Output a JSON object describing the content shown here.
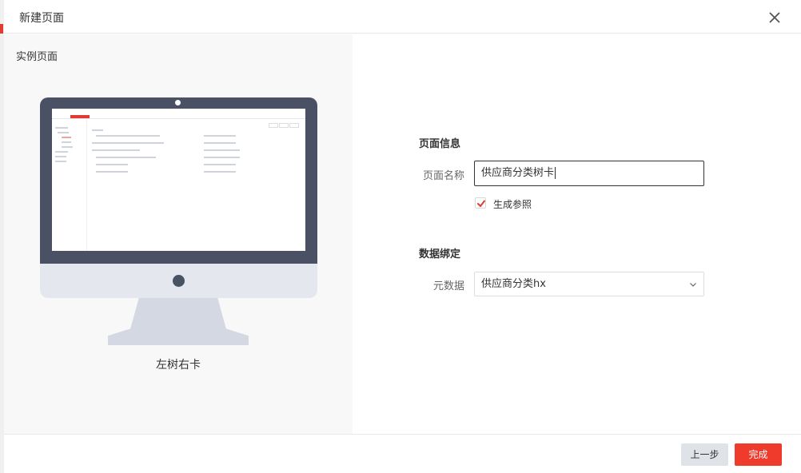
{
  "modal": {
    "title": "新建页面",
    "close_icon": "close-icon"
  },
  "preview": {
    "title": "实例页面",
    "template_name": "左树右卡"
  },
  "page_info": {
    "section_title": "页面信息",
    "name_label": "页面名称",
    "name_value": "供应商分类树卡",
    "generate_ref_label": "生成参照",
    "generate_ref_checked": true
  },
  "data_binding": {
    "section_title": "数据绑定",
    "metadata_label": "元数据",
    "metadata_value": "供应商分类hx"
  },
  "footer": {
    "prev_label": "上一步",
    "done_label": "完成"
  },
  "colors": {
    "primary": "#ee3b2c",
    "monitor": "#4b5164"
  }
}
